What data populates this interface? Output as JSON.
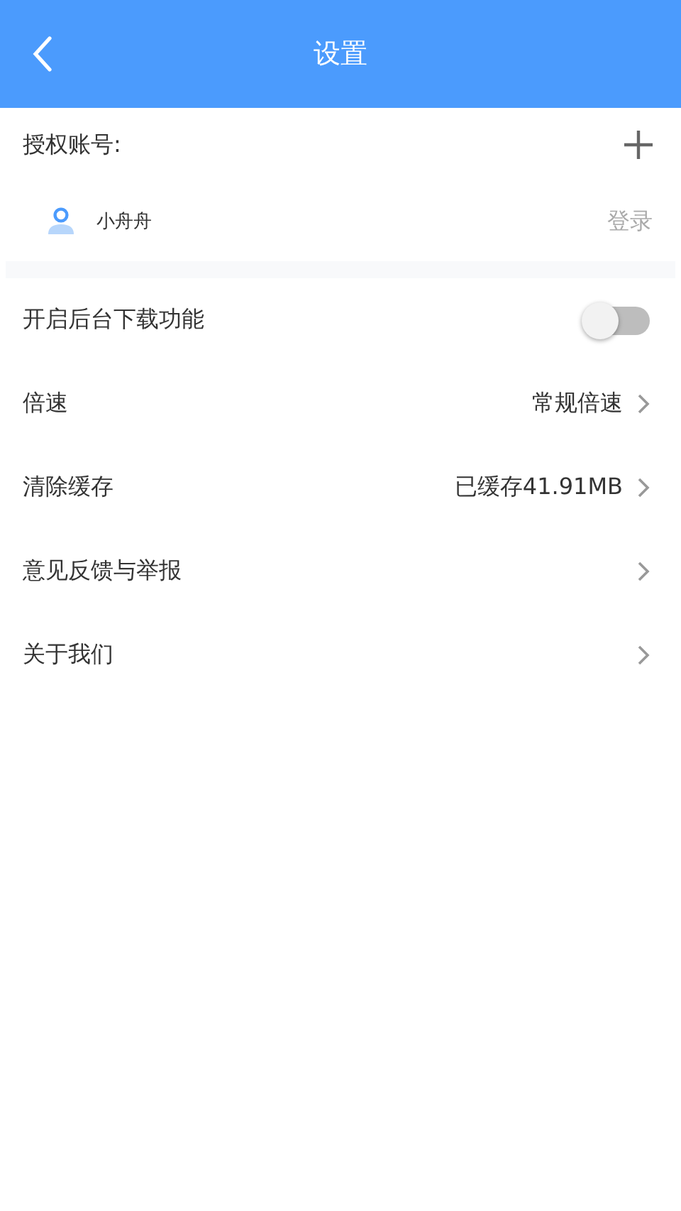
{
  "header": {
    "title": "设置"
  },
  "accounts": {
    "label": "授权账号:",
    "items": [
      {
        "name": "小舟舟",
        "action": "登录"
      }
    ]
  },
  "settings": [
    {
      "kind": "toggle",
      "label": "开启后台下载功能",
      "on": false
    },
    {
      "kind": "link",
      "label": "倍速",
      "value": "常规倍速"
    },
    {
      "kind": "link",
      "label": "清除缓存",
      "value": "已缓存41.91MB"
    },
    {
      "kind": "link",
      "label": "意见反馈与举报"
    },
    {
      "kind": "link",
      "label": "关于我们"
    }
  ]
}
